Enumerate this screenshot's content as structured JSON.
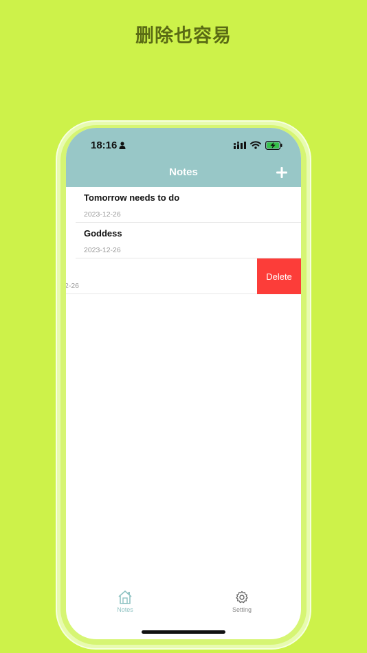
{
  "headline": "删除也容易",
  "status_bar": {
    "time": "18:16"
  },
  "nav": {
    "title": "Notes"
  },
  "notes": [
    {
      "title": "Tomorrow needs to do",
      "date": "2023-12-26"
    },
    {
      "title": "Goddess",
      "date": "2023-12-26"
    },
    {
      "title": "",
      "date": "2-26"
    }
  ],
  "swipe_action": {
    "label": "Delete"
  },
  "tabs": [
    {
      "label": "Notes",
      "icon": "home-icon",
      "active": true
    },
    {
      "label": "Setting",
      "icon": "gear-icon",
      "active": false
    }
  ],
  "colors": {
    "background": "#cdf24a",
    "nav_bar": "#98c7c7",
    "delete": "#fc3d39",
    "active_tab": "#8fc3c3"
  }
}
